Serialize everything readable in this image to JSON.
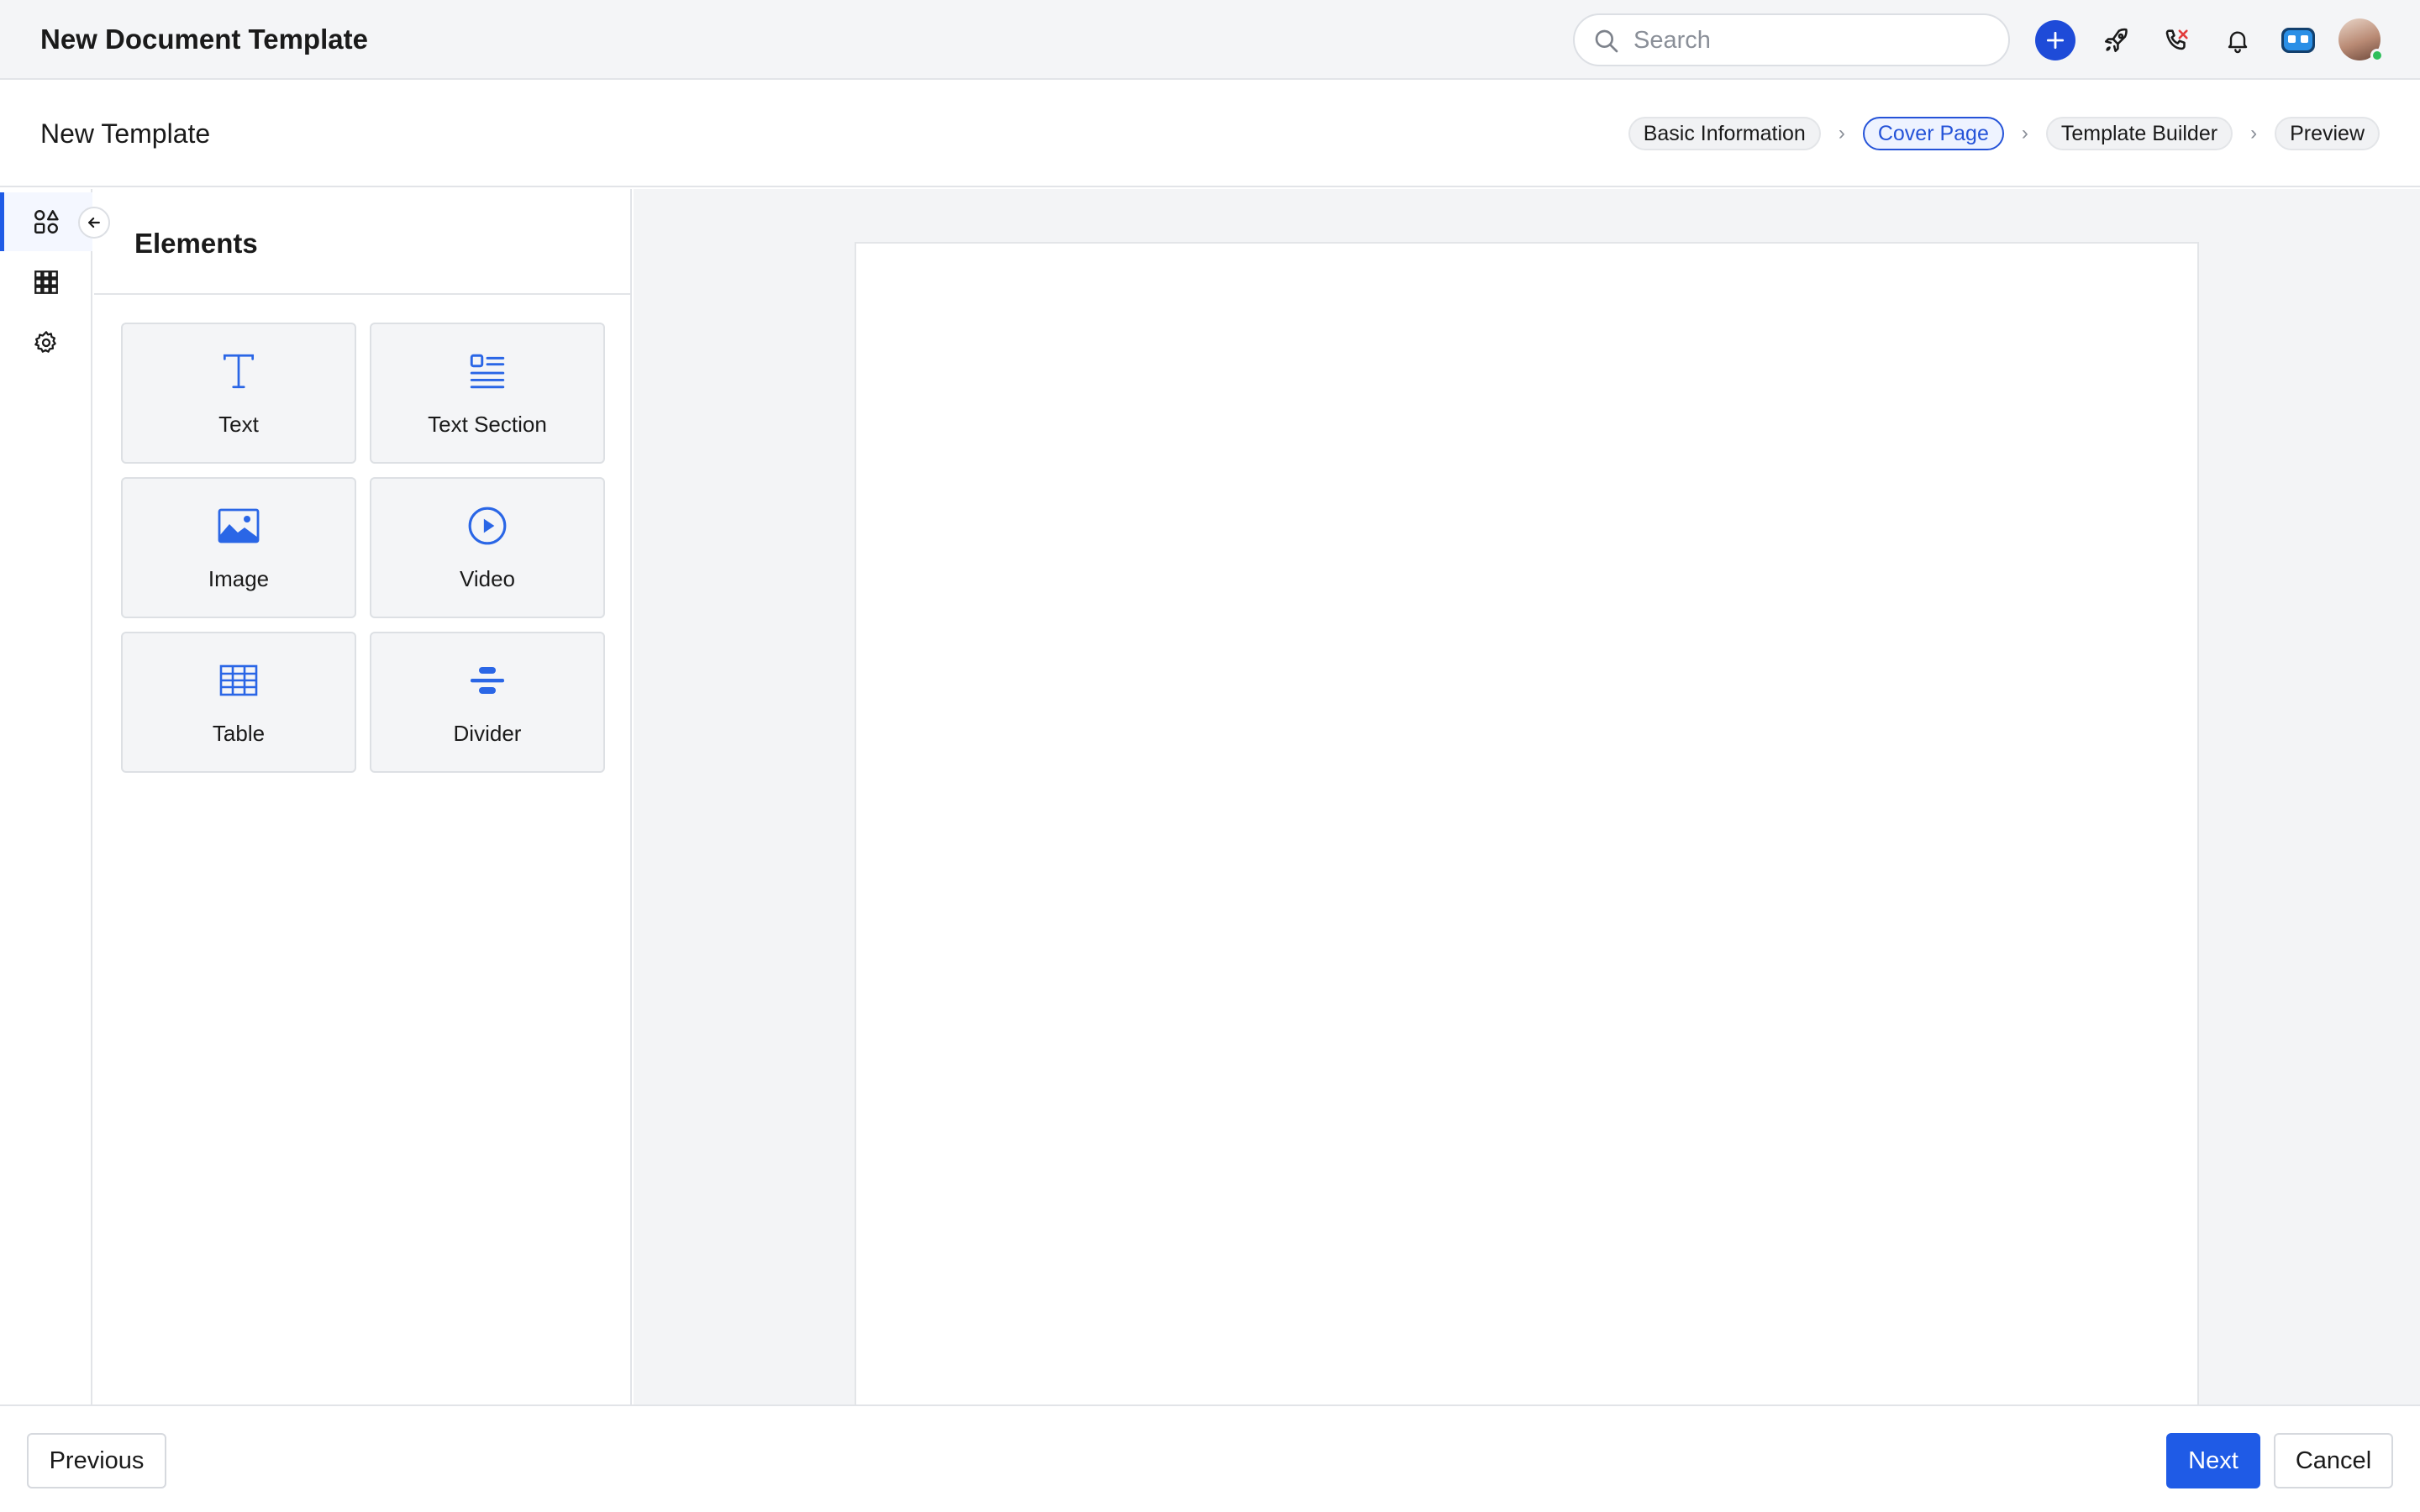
{
  "header": {
    "title": "New Document Template",
    "search_placeholder": "Search",
    "icons": [
      "search-icon",
      "plus-icon",
      "rocket-icon",
      "phone-off-icon",
      "bell-icon",
      "bot-icon",
      "avatar"
    ]
  },
  "subheader": {
    "title": "New Template",
    "steps": [
      {
        "label": "Basic Information",
        "active": false
      },
      {
        "label": "Cover Page",
        "active": true
      },
      {
        "label": "Template Builder",
        "active": false
      },
      {
        "label": "Preview",
        "active": false
      }
    ]
  },
  "rail": {
    "items": [
      {
        "icon": "shapes-icon",
        "active": true
      },
      {
        "icon": "layout-grid-icon",
        "active": false
      },
      {
        "icon": "gear-icon",
        "active": false
      }
    ],
    "collapse_icon": "arrow-left-icon"
  },
  "panel": {
    "title": "Elements",
    "tiles": [
      {
        "label": "Text",
        "icon": "text-icon"
      },
      {
        "label": "Text Section",
        "icon": "text-section-icon"
      },
      {
        "label": "Image",
        "icon": "image-icon"
      },
      {
        "label": "Video",
        "icon": "video-play-icon"
      },
      {
        "label": "Table",
        "icon": "table-icon"
      },
      {
        "label": "Divider",
        "icon": "divider-icon"
      }
    ]
  },
  "footer": {
    "previous_label": "Previous",
    "next_label": "Next",
    "cancel_label": "Cancel"
  },
  "colors": {
    "primary": "#1f5be6",
    "header_bg": "#f4f5f7",
    "canvas_bg": "#f3f4f6",
    "icon_blue": "#2a66e6",
    "online": "#2fbf5b"
  }
}
